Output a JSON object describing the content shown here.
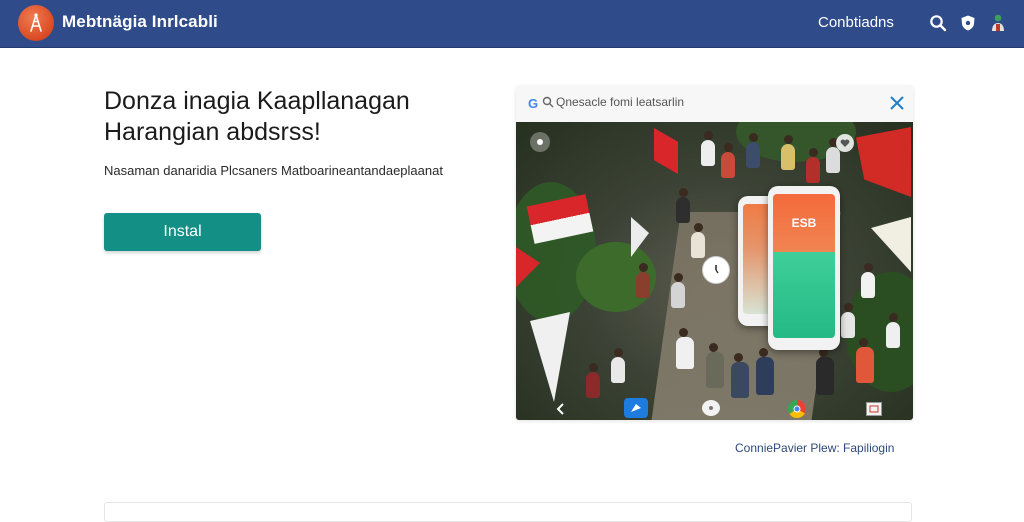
{
  "header": {
    "app_title": "Mebtnägia Inrlcabli",
    "link_label": "Conbtiadns",
    "logo_icon": "app-logo",
    "search_icon": "search-icon",
    "shield_icon": "shield-icon",
    "avatar_icon": "user-avatar-icon",
    "bg_color": "#2f4b8a"
  },
  "hero": {
    "title_line1": "Donza inagia Kaapllanagan",
    "title_line2": "Harangian abdsrss!",
    "description": "Nasaman danaridia Plcsaners Matboarineantandaeplaanat",
    "install_label": "Instal",
    "install_color": "#138f86"
  },
  "preview": {
    "address_text": "Qnesacle fomi leatsarlin",
    "close_icon": "close-icon",
    "phone_text": "ESB",
    "caption": "ConniePavier Plew: Fapiliogin"
  }
}
